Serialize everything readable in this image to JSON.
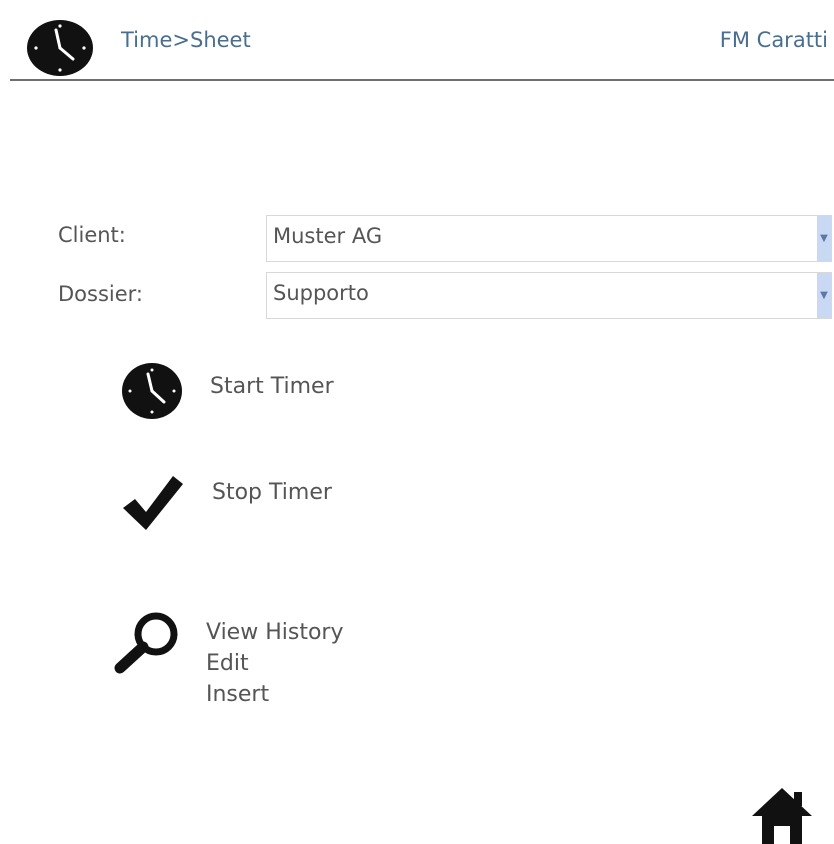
{
  "header": {
    "app_title": "Time>Sheet",
    "user_name": "FM Caratti"
  },
  "form": {
    "client": {
      "label": "Client:",
      "value": "Muster AG"
    },
    "dossier": {
      "label": "Dossier:",
      "value": "Supporto"
    }
  },
  "actions": {
    "start_timer": "Start Timer",
    "stop_timer": "Stop Timer",
    "view_history": "View History",
    "edit": "Edit",
    "insert": "Insert"
  },
  "icons": {
    "logo": "clock-icon",
    "start": "clock-icon",
    "stop": "checkmark-icon",
    "history": "magnifier-icon",
    "home": "home-icon"
  },
  "colors": {
    "header_text": "#4a6e8f",
    "body_text": "#555555",
    "icon": "#111111",
    "select_arrow_bg": "#c9d9f3"
  }
}
